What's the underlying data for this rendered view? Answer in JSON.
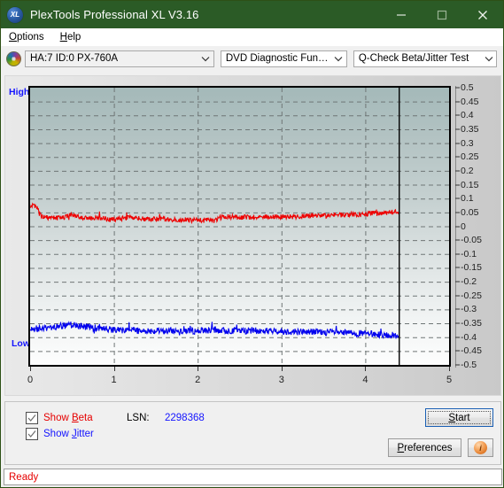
{
  "window": {
    "title": "PlexTools Professional XL V3.16",
    "logo_text": "XL",
    "logo_icon": "xl-logo-icon",
    "minimize_icon": "minimize-icon",
    "maximize_icon": "maximize-icon",
    "close_icon": "close-icon",
    "titlebar_color": "#2b5b26"
  },
  "menubar": {
    "items": [
      {
        "label": "Options",
        "accel": "O"
      },
      {
        "label": "Help",
        "accel": "H"
      }
    ]
  },
  "toolbar": {
    "drive_icon": "optical-disc-icon",
    "drive_select": {
      "value": "HA:7 ID:0  PX-760A",
      "chevron": "chevron-down-icon"
    },
    "function_select": {
      "value": "DVD Diagnostic Functions",
      "chevron": "chevron-down-icon"
    },
    "test_select": {
      "value": "Q-Check Beta/Jitter Test",
      "chevron": "chevron-down-icon"
    }
  },
  "chart_data": {
    "type": "line",
    "title": "",
    "xlabel": "",
    "ylabel": "",
    "xlim": [
      0,
      5
    ],
    "ylim": [
      -0.5,
      0.5
    ],
    "grid": true,
    "legend_position": "below-left",
    "x_ticks": [
      0,
      1,
      2,
      3,
      4,
      5
    ],
    "x_tick_labels": [
      "0",
      "1",
      "2",
      "3",
      "4",
      "5"
    ],
    "y_ticks": [
      0.5,
      0.45,
      0.4,
      0.35,
      0.3,
      0.25,
      0.2,
      0.15,
      0.1,
      0.05,
      0,
      -0.05,
      -0.1,
      -0.15,
      -0.2,
      -0.25,
      -0.3,
      -0.35,
      -0.4,
      -0.45,
      -0.5
    ],
    "y_tick_labels": [
      "0.5",
      "0.45",
      "0.4",
      "0.35",
      "0.3",
      "0.25",
      "0.2",
      "0.15",
      "0.1",
      "0.05",
      "0",
      "-0.05",
      "-0.1",
      "-0.15",
      "-0.2",
      "-0.25",
      "-0.3",
      "-0.35",
      "-0.4",
      "-0.45",
      "-0.5"
    ],
    "high_label": "High",
    "low_label": "Low",
    "data_end_x": 4.4,
    "cursor_line_x": 4.4,
    "series": [
      {
        "name": "Beta",
        "color": "#ee0000",
        "x": [
          0.0,
          0.03,
          0.06,
          0.09,
          0.12,
          0.18,
          0.24,
          0.3,
          0.36,
          0.42,
          0.48,
          0.54,
          0.6,
          0.66,
          0.72,
          0.78,
          0.84,
          0.9,
          0.96,
          1.02,
          1.08,
          1.14,
          1.2,
          1.26,
          1.32,
          1.38,
          1.44,
          1.5,
          1.56,
          1.62,
          1.68,
          1.74,
          1.8,
          1.86,
          1.92,
          1.98,
          2.04,
          2.1,
          2.16,
          2.22,
          2.28,
          2.34,
          2.4,
          2.46,
          2.52,
          2.58,
          2.64,
          2.7,
          2.76,
          2.82,
          2.88,
          2.94,
          3.0,
          3.06,
          3.12,
          3.18,
          3.24,
          3.3,
          3.36,
          3.42,
          3.48,
          3.54,
          3.6,
          3.66,
          3.72,
          3.78,
          3.84,
          3.9,
          3.96,
          4.02,
          4.08,
          4.14,
          4.2,
          4.26,
          4.32,
          4.38,
          4.4
        ],
        "y": [
          0.075,
          0.073,
          0.07,
          0.06,
          0.04,
          0.033,
          0.03,
          0.031,
          0.03,
          0.034,
          0.041,
          0.035,
          0.032,
          0.03,
          0.029,
          0.031,
          0.03,
          0.028,
          0.026,
          0.025,
          0.027,
          0.03,
          0.032,
          0.029,
          0.027,
          0.026,
          0.025,
          0.026,
          0.028,
          0.027,
          0.025,
          0.024,
          0.023,
          0.023,
          0.022,
          0.022,
          0.021,
          0.022,
          0.021,
          0.021,
          0.033,
          0.035,
          0.034,
          0.033,
          0.032,
          0.034,
          0.033,
          0.032,
          0.034,
          0.035,
          0.033,
          0.034,
          0.035,
          0.036,
          0.034,
          0.035,
          0.036,
          0.038,
          0.037,
          0.039,
          0.041,
          0.038,
          0.04,
          0.042,
          0.04,
          0.042,
          0.043,
          0.041,
          0.043,
          0.045,
          0.048,
          0.046,
          0.047,
          0.049,
          0.052,
          0.05,
          0.049
        ],
        "noise": 0.009,
        "description": "Beta value trace, starts near 0.075 then settles around 0.02-0.05"
      },
      {
        "name": "Jitter",
        "color": "#0000ee",
        "x": [
          0.0,
          0.06,
          0.12,
          0.18,
          0.24,
          0.3,
          0.36,
          0.42,
          0.48,
          0.54,
          0.6,
          0.66,
          0.72,
          0.78,
          0.84,
          0.9,
          0.96,
          1.02,
          1.08,
          1.14,
          1.2,
          1.26,
          1.32,
          1.38,
          1.44,
          1.5,
          1.56,
          1.62,
          1.68,
          1.74,
          1.8,
          1.86,
          1.92,
          1.98,
          2.04,
          2.1,
          2.16,
          2.22,
          2.28,
          2.34,
          2.4,
          2.46,
          2.52,
          2.58,
          2.64,
          2.7,
          2.76,
          2.82,
          2.88,
          2.94,
          3.0,
          3.06,
          3.12,
          3.18,
          3.24,
          3.3,
          3.36,
          3.42,
          3.48,
          3.54,
          3.6,
          3.66,
          3.72,
          3.78,
          3.84,
          3.9,
          3.96,
          4.02,
          4.08,
          4.14,
          4.2,
          4.26,
          4.32,
          4.38,
          4.4
        ],
        "y": [
          -0.372,
          -0.37,
          -0.368,
          -0.366,
          -0.364,
          -0.362,
          -0.36,
          -0.358,
          -0.356,
          -0.358,
          -0.36,
          -0.362,
          -0.364,
          -0.366,
          -0.368,
          -0.37,
          -0.372,
          -0.374,
          -0.376,
          -0.375,
          -0.374,
          -0.376,
          -0.378,
          -0.377,
          -0.376,
          -0.378,
          -0.379,
          -0.378,
          -0.377,
          -0.376,
          -0.375,
          -0.376,
          -0.377,
          -0.378,
          -0.376,
          -0.375,
          -0.374,
          -0.375,
          -0.376,
          -0.377,
          -0.376,
          -0.375,
          -0.376,
          -0.377,
          -0.376,
          -0.377,
          -0.378,
          -0.377,
          -0.378,
          -0.379,
          -0.378,
          -0.379,
          -0.38,
          -0.379,
          -0.38,
          -0.381,
          -0.38,
          -0.381,
          -0.382,
          -0.383,
          -0.382,
          -0.383,
          -0.384,
          -0.385,
          -0.384,
          -0.386,
          -0.387,
          -0.388,
          -0.389,
          -0.39,
          -0.391,
          -0.392,
          -0.393,
          -0.395,
          -0.396
        ],
        "noise": 0.012,
        "description": "Jitter value trace, band roughly -0.35 to -0.41"
      }
    ]
  },
  "controls": {
    "show_beta": {
      "label_prefix": "Show ",
      "label_accel": "B",
      "label_suffix": "eta",
      "checked": true,
      "color": "#e60000"
    },
    "show_jitter": {
      "label_prefix": "Show ",
      "label_accel": "J",
      "label_suffix": "itter",
      "checked": true,
      "color": "#1414ff"
    },
    "lsn_label": "LSN:",
    "lsn_value": "2298368",
    "start_button": {
      "prefix": "",
      "accel": "S",
      "suffix": "tart"
    },
    "preferences_button": {
      "prefix": "",
      "accel": "P",
      "suffix": "references"
    },
    "info_button": {
      "icon": "info-icon",
      "glyph": "i"
    }
  },
  "statusbar": {
    "text": "Ready",
    "color": "#e60000"
  }
}
